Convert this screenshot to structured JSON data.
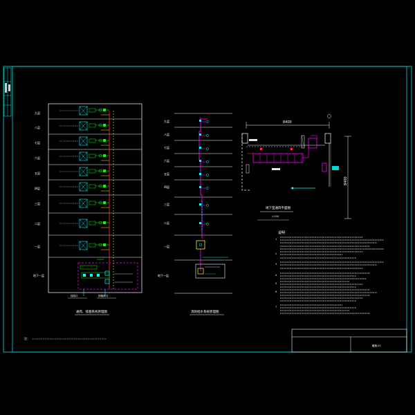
{
  "colors": {
    "background": "#000000",
    "frame": "#00e5e5",
    "line": "#ffffff",
    "magenta": "#ff00ff",
    "cyan": "#00ffff",
    "yellow": "#ffff00",
    "green": "#00ff00",
    "red": "#ff3030"
  },
  "left_diagram": {
    "floor_labels": [
      "九层",
      "八层",
      "七层",
      "六层",
      "五层",
      "四层",
      "三层",
      "二层",
      "一层",
      "地下一层"
    ],
    "bottom_labels": [
      "排风口",
      "排烟风口"
    ],
    "title": "通风、排烟系统原理图"
  },
  "middle_diagram": {
    "floor_labels": [
      "九层",
      "八层",
      "七层",
      "六层",
      "五层",
      "四层",
      "三层",
      "二层",
      "一层",
      "地下一层"
    ],
    "title": "消防给水系统原理图"
  },
  "right_plan": {
    "dimension_top": "8400",
    "dimension_right": "8400",
    "title": "地下室通风平面图",
    "scale": "1:100"
  },
  "notes": {
    "heading": "说明",
    "numbers": [
      "1",
      "2",
      "3",
      "4",
      "5",
      "6",
      "7"
    ]
  },
  "bottom_note": "注：",
  "title_block": {
    "drawing_no": "暖施-01"
  }
}
